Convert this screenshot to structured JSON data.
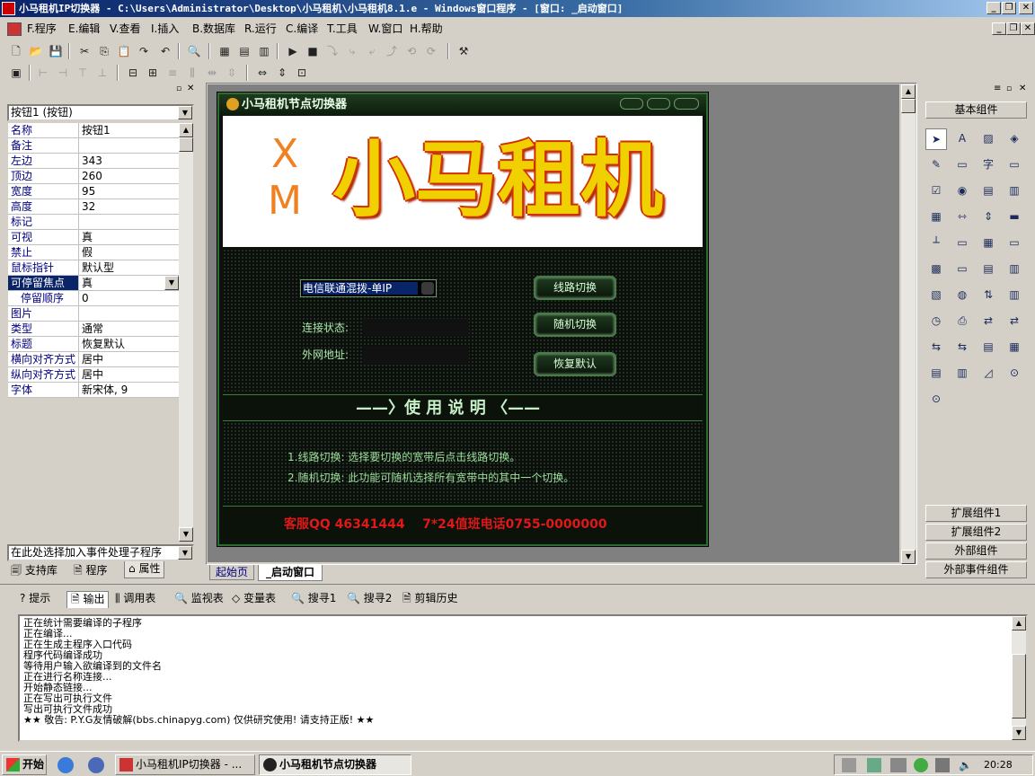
{
  "window": {
    "title": "小马租机IP切换器 - C:\\Users\\Administrator\\Desktop\\小马租机\\小马租机8.1.e - Windows窗口程序 - [窗口: _启动窗口]"
  },
  "menu": [
    {
      "key": "F.",
      "label": "程序"
    },
    {
      "key": "E.",
      "label": "编辑"
    },
    {
      "key": "V.",
      "label": "查看"
    },
    {
      "key": "I.",
      "label": "插入"
    },
    {
      "key": "B.",
      "label": "数据库"
    },
    {
      "key": "R.",
      "label": "运行"
    },
    {
      "key": "C.",
      "label": "编译"
    },
    {
      "key": "T.",
      "label": "工具"
    },
    {
      "key": "W.",
      "label": "窗口"
    },
    {
      "key": "H.",
      "label": "帮助"
    }
  ],
  "left": {
    "selected_component": "按钮1 (按钮)",
    "properties": [
      {
        "name": "名称",
        "value": "按钮1"
      },
      {
        "name": "备注",
        "value": ""
      },
      {
        "name": "左边",
        "value": "343"
      },
      {
        "name": "顶边",
        "value": "260"
      },
      {
        "name": "宽度",
        "value": "95"
      },
      {
        "name": "高度",
        "value": "32"
      },
      {
        "name": "标记",
        "value": ""
      },
      {
        "name": "可视",
        "value": "真"
      },
      {
        "name": "禁止",
        "value": "假"
      },
      {
        "name": "鼠标指针",
        "value": "默认型"
      },
      {
        "name": "可停留焦点",
        "value": "真"
      },
      {
        "name": "停留顺序",
        "value": "0"
      },
      {
        "name": "图片",
        "value": ""
      },
      {
        "name": "类型",
        "value": "通常"
      },
      {
        "name": "标题",
        "value": "恢复默认"
      },
      {
        "name": "横向对齐方式",
        "value": "居中"
      },
      {
        "name": "纵向对齐方式",
        "value": "居中"
      },
      {
        "name": "字体",
        "value": "新宋体, 9"
      }
    ],
    "event_combo": "在此处选择加入事件处理子程序",
    "tabs": [
      "支持库",
      "程序",
      "属性"
    ]
  },
  "editor_tabs": [
    "起始页",
    "_启动窗口"
  ],
  "form": {
    "title": "小马租机节点切换器",
    "logo_side": [
      "X",
      "M"
    ],
    "logo_text": "小马租机",
    "line_combo": "电信联通混拨-单IP",
    "status_label": "连接状态:",
    "ip_label": "外网地址:",
    "btn_switch": "线路切换",
    "btn_random": "随机切换",
    "btn_restore": "恢复默认",
    "help_title": "——〉使 用 说 明 〈——",
    "help_line1": "1.线路切换: 选择要切换的宽带后点击线路切换。",
    "help_line2": "2.随机切换: 此功能可随机选择所有宽带中的其中一个切换。",
    "contact": "客服QQ 46341444    7*24值班电话0755-0000000"
  },
  "right": {
    "header": "基本组件",
    "groups": [
      "扩展组件1",
      "扩展组件2",
      "外部组件",
      "外部事件组件"
    ],
    "icons": [
      "pointer-icon",
      "label-icon",
      "image-icon",
      "shape-icon",
      "edit-icon",
      "frame-icon",
      "text-char-icon",
      "rect-icon",
      "checkbox-icon",
      "radio-icon",
      "listbox-icon",
      "combobox-icon",
      "grid-icon",
      "hscroll-icon",
      "vscroll-icon",
      "progress-icon",
      "ruler-icon",
      "tabs-icon",
      "calendar-icon",
      "drive-icon",
      "table-icon",
      "button-icon",
      "dir-icon",
      "file-icon",
      "chart-icon",
      "globe-icon",
      "spin-icon",
      "align-icon",
      "timer-icon",
      "printer-icon",
      "net-icon",
      "net2-icon",
      "net3-icon",
      "net4-icon",
      "grid2-icon",
      "grid3-icon",
      "db-icon",
      "db2-icon",
      "chartline-icon",
      "odbc-icon",
      "odbc2-icon"
    ]
  },
  "output": {
    "tabs": [
      "提示",
      "输出",
      "调用表",
      "监视表",
      "变量表",
      "搜寻1",
      "搜寻2",
      "剪辑历史"
    ],
    "lines": [
      "正在统计需要编译的子程序",
      "正在编译...",
      "正在生成主程序入口代码",
      "程序代码编译成功",
      "等待用户输入欲编译到的文件名",
      "正在进行名称连接...",
      "开始静态链接...",
      "正在写出可执行文件",
      "写出可执行文件成功",
      "★★ 敬告: P.Y.G友情破解(bbs.chinapyg.com) 仅供研究使用! 请支持正版! ★★"
    ]
  },
  "taskbar": {
    "start": "开始",
    "tasks": [
      "小马租机IP切换器 - ...",
      "小马租机节点切换器"
    ],
    "clock": "20:28"
  }
}
